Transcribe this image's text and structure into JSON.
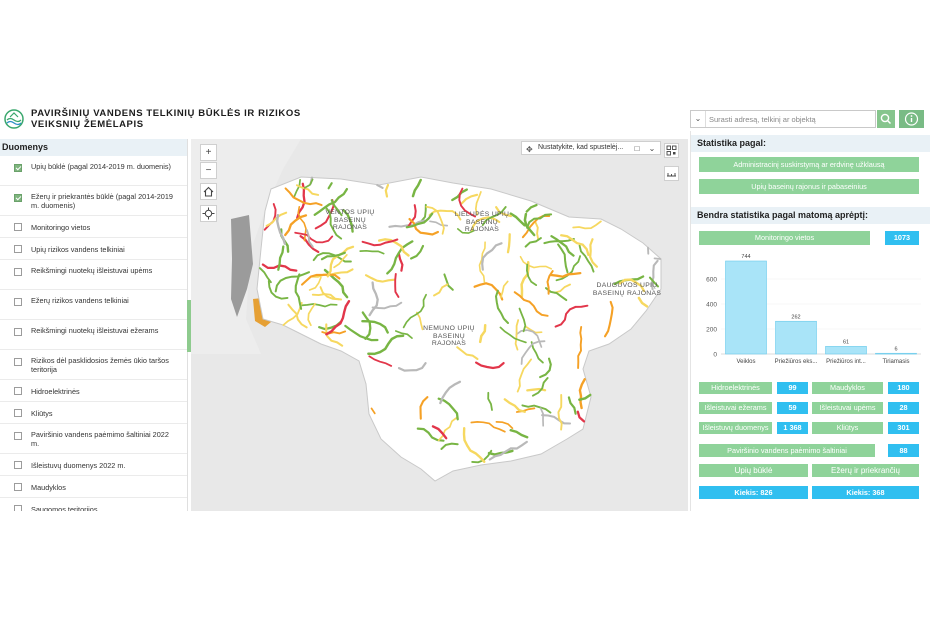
{
  "header": {
    "title": "Paviršinių vandens telkinių būklės ir rizikos veiksnių žemėlapis",
    "search_placeholder": "Surasti adresą, telkinį ar objektą"
  },
  "layers_panel": {
    "title": "Duomenys",
    "items": [
      {
        "label": "Upių būklė (pagal 2014-2019 m. duomenis)",
        "checked": true
      },
      {
        "label": "Ežerų ir priekrantės būklė (pagal 2014-2019 m. duomenis)",
        "checked": true
      },
      {
        "label": "Monitoringo vietos",
        "checked": false
      },
      {
        "label": "Upių rizikos vandens telkiniai",
        "checked": false
      },
      {
        "label": "Reikšmingi nuotekų išleistuvai upėms",
        "checked": false
      },
      {
        "label": "Ežerų rizikos vandens telkiniai",
        "checked": false
      },
      {
        "label": "Reikšmingi nuotekų išleistuvai ežerams",
        "checked": false
      },
      {
        "label": "Rizikos dėl pasklidosios žemės ūkio taršos teritorija",
        "checked": false
      },
      {
        "label": "Hidroelektrinės",
        "checked": false
      },
      {
        "label": "Kliūtys",
        "checked": false
      },
      {
        "label": "Paviršinio vandens paėmimo šaltiniai 2022 m.",
        "checked": false
      },
      {
        "label": "Išleistuvų duomenys 2022 m.",
        "checked": false
      },
      {
        "label": "Maudyklos",
        "checked": false
      },
      {
        "label": "Saugomos teritorijos",
        "checked": false
      }
    ]
  },
  "map": {
    "coord_tool": "Nustatykite, kad spustelėj...",
    "basins": [
      {
        "name": "VENTOS UPIŲ BASEINŲ RAJONAS"
      },
      {
        "name": "LIELUPĖS UPIŲ BASEINŲ RAJONAS"
      },
      {
        "name": "DAUGUVOS UPIŲ BASEINŲ RAJONAS"
      },
      {
        "name": "NEMUNO UPIŲ BASEINŲ RAJONAS"
      }
    ],
    "colors": {
      "good": "#78b544",
      "moderate": "#f6d860",
      "poor": "#f5a126",
      "bad": "#e2364a",
      "water": "#b9b9b9"
    }
  },
  "stats": {
    "title": "Statistika pagal:",
    "btn_admin": "Administracinį suskirstymą ar erdvinę užklausą",
    "btn_basin": "Upių baseinų rajonus ir pabaseinius",
    "extent_title": "Bendra statistika pagal matomą aprėptį:",
    "monitoring_label": "Monitoringo vietos",
    "monitoring_value": "1073",
    "rows": [
      [
        {
          "label": "Hidroelektrinės",
          "value": "99"
        },
        {
          "label": "Maudyklos",
          "value": "180"
        }
      ],
      [
        {
          "label": "Išleistuvai ežerams",
          "value": "59"
        },
        {
          "label": "Išleistuvai upėms",
          "value": "28"
        }
      ],
      [
        {
          "label": "Išleistuvų duomenys",
          "value": "1 368"
        },
        {
          "label": "Kliūtys",
          "value": "301"
        }
      ]
    ],
    "intake_label": "Paviršinio vandens paėmimo šaltiniai",
    "intake_value": "88",
    "river_label": "Upių būklė",
    "lake_label": "Ežerų ir priekrančių",
    "river_count": "Kiekis: 826",
    "lake_count": "Kiekis: 368",
    "colors": {
      "green": "#8fd39a",
      "blue": "#30bff0",
      "bar": "#a9e4f8",
      "bar_stroke": "#6ccbeb"
    }
  },
  "chart_data": {
    "type": "bar",
    "categories": [
      "Veiklos",
      "Priežiūros eks...",
      "Priežiūros int...",
      "Tiriamasis"
    ],
    "values": [
      744,
      262,
      61,
      6
    ],
    "ylim": [
      0,
      800
    ],
    "yticks": [
      0,
      200,
      400,
      600
    ],
    "xlabel": "",
    "ylabel": ""
  }
}
